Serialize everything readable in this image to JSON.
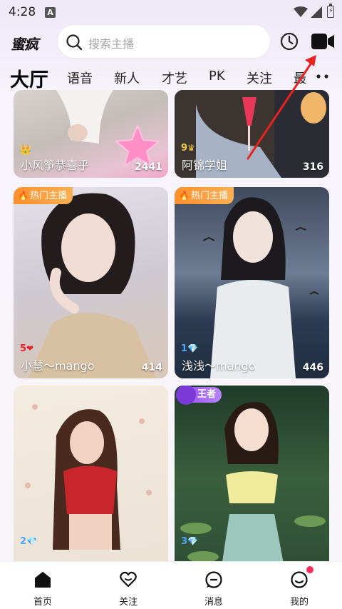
{
  "status_bar": {
    "time": "4:28",
    "notification_letter": "A"
  },
  "header": {
    "logo": "蜜疯",
    "search": {
      "placeholder": "搜索主播"
    },
    "history_icon": "clock-icon",
    "camera_icon": "video-camera-icon"
  },
  "tabs": [
    {
      "label": "大厅",
      "active": true
    },
    {
      "label": "语音"
    },
    {
      "label": "新人"
    },
    {
      "label": "才艺"
    },
    {
      "label": "PK"
    },
    {
      "label": "关注"
    },
    {
      "label": "最"
    }
  ],
  "cards": [
    {
      "name": "小风筝恭喜乎",
      "count": "2441",
      "level": ""
    },
    {
      "name": "阿锦学姐",
      "count": "316",
      "level": "9"
    },
    {
      "name": "小慧～mango",
      "count": "414",
      "badge": "热门主播",
      "level": "5"
    },
    {
      "name": "浅浅～mango",
      "count": "446",
      "badge": "热门主播",
      "level": "1"
    },
    {
      "name": "",
      "count": "",
      "level": "2"
    },
    {
      "name": "",
      "count": "",
      "badge": "王者",
      "level": "3"
    }
  ],
  "bottom_nav": [
    {
      "label": "首页",
      "icon": "home-icon",
      "active": true
    },
    {
      "label": "关注",
      "icon": "heart-icon"
    },
    {
      "label": "消息",
      "icon": "message-icon"
    },
    {
      "label": "我的",
      "icon": "profile-icon"
    }
  ],
  "colors": {
    "accent_orange": "#ff9a3c",
    "king_purple": "#9b59f0",
    "annotation_red": "#e8231f",
    "notification_dot": "#ff2b5a"
  }
}
